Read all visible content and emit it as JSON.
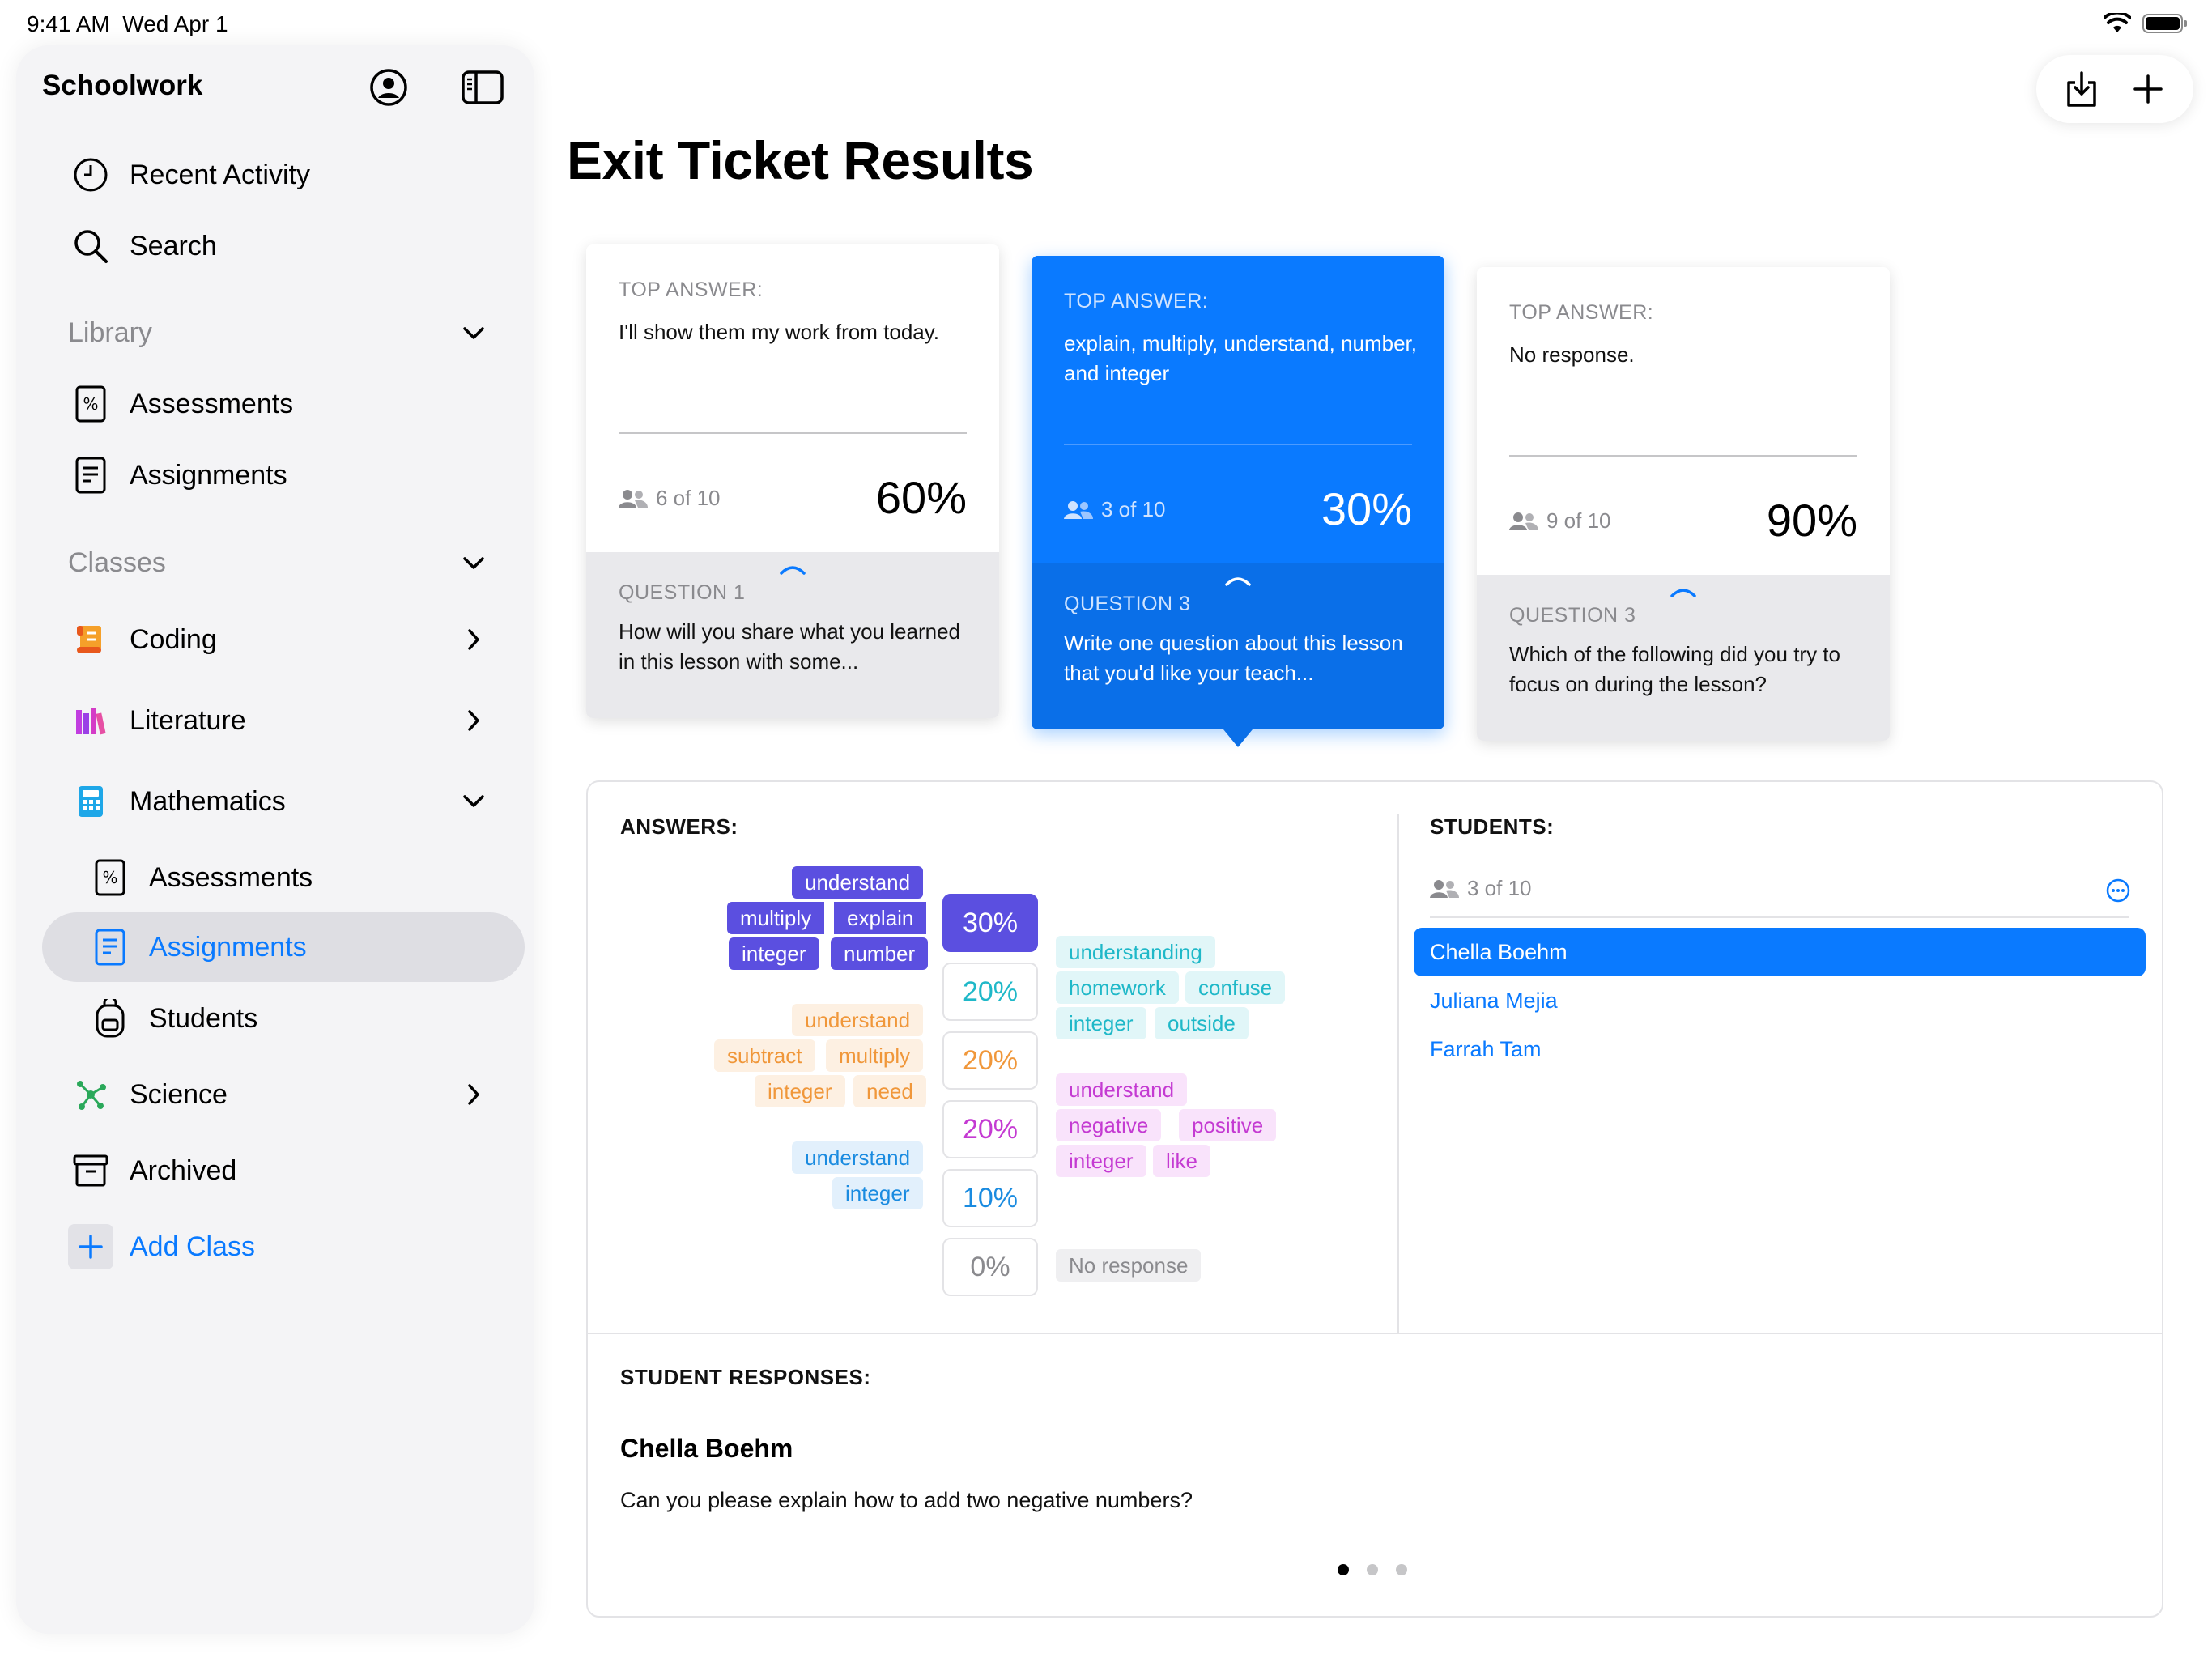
{
  "status": {
    "time": "9:41 AM",
    "date": "Wed Apr 1"
  },
  "sidebar": {
    "title": "Schoolwork",
    "recent_activity": "Recent Activity",
    "search": "Search",
    "library_label": "Library",
    "library_items": [
      "Assessments",
      "Assignments"
    ],
    "classes_label": "Classes",
    "classes": [
      "Coding",
      "Literature",
      "Mathematics"
    ],
    "math_items": [
      "Assessments",
      "Assignments",
      "Students"
    ],
    "science": "Science",
    "archived": "Archived",
    "add_class": "Add Class"
  },
  "main": {
    "title": "Exit Ticket Results"
  },
  "cards": [
    {
      "top_label": "TOP ANSWER:",
      "answer": "I'll show them my work from today.",
      "count": "6 of 10",
      "percent": "60%",
      "q_label": "QUESTION 1",
      "question": "How will you share what you learned in this lesson with some..."
    },
    {
      "top_label": "TOP ANSWER:",
      "answer": "explain, multiply, understand, number, and integer",
      "count": "3 of 10",
      "percent": "30%",
      "q_label": "QUESTION 3",
      "question": "Write one question about this lesson that you'd like your teach..."
    },
    {
      "top_label": "TOP ANSWER:",
      "answer": "No response.",
      "count": "9 of 10",
      "percent": "90%",
      "q_label": "QUESTION 3",
      "question": "Which of the following did you try to focus on during the lesson?"
    }
  ],
  "answers": {
    "heading": "ANSWERS:",
    "percents": [
      "30%",
      "20%",
      "20%",
      "20%",
      "10%",
      "0%"
    ],
    "group1": [
      "understand",
      "multiply",
      "explain",
      "integer",
      "number"
    ],
    "group2": [
      "understanding",
      "homework",
      "confuse",
      "integer",
      "outside"
    ],
    "group3": [
      "understand",
      "subtract",
      "multiply",
      "integer",
      "need"
    ],
    "group4": [
      "understand",
      "negative",
      "positive",
      "integer",
      "like"
    ],
    "group5": [
      "understand",
      "integer"
    ],
    "no_response": "No response"
  },
  "students": {
    "heading": "STUDENTS:",
    "count": "3 of 10",
    "list": [
      "Chella Boehm",
      "Juliana Mejia",
      "Farrah Tam"
    ]
  },
  "responses": {
    "heading": "STUDENT RESPONSES:",
    "name": "Chella Boehm",
    "text": "Can you please explain how to add two negative numbers?"
  },
  "colors": {
    "accent": "#0a7aff",
    "purple": "#5b4fe0",
    "teal": "#1fb8c8",
    "orange": "#f0973a",
    "magenta": "#c43ad2",
    "blue_light": "#1a8be0"
  }
}
